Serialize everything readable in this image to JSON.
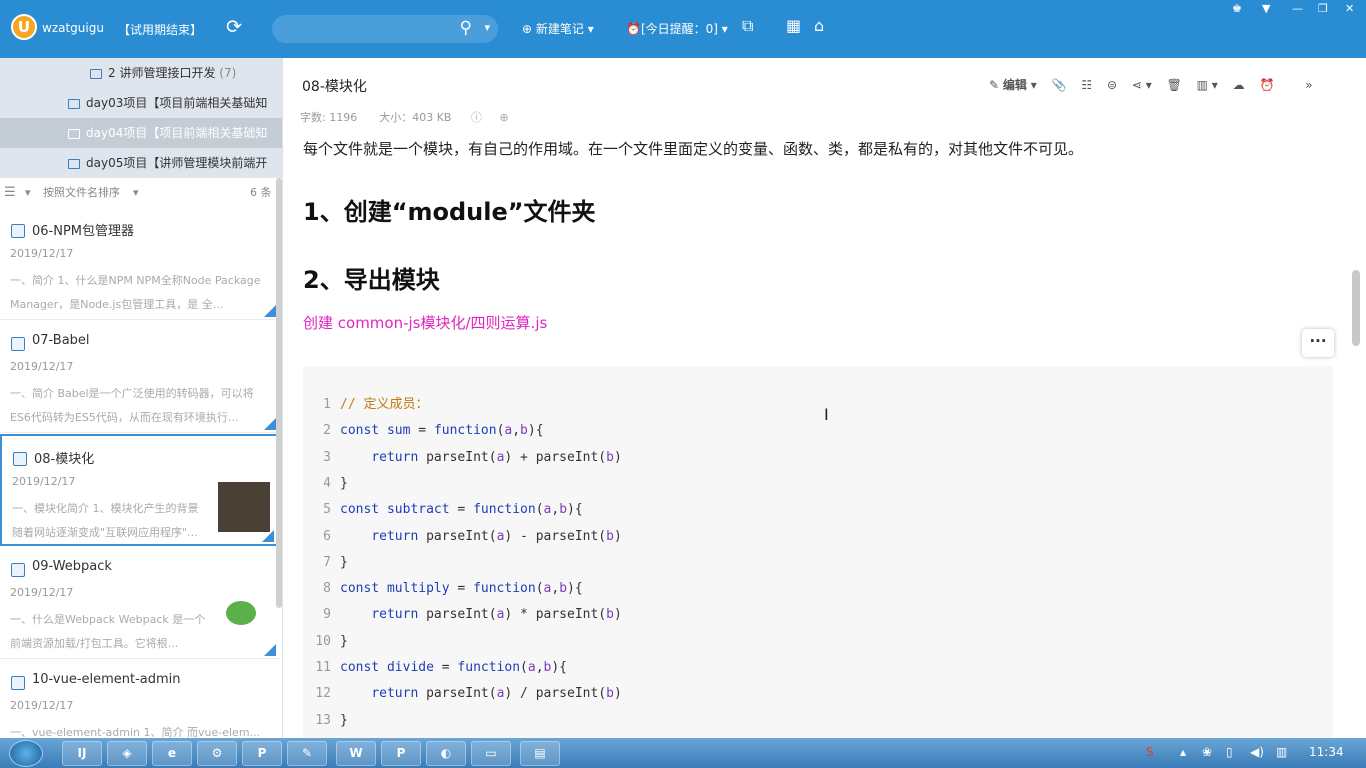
{
  "app": {
    "username": "wzatguigu",
    "trial_label": "【试用期结束】",
    "new_note_label": "新建笔记",
    "reminder_label": "[今日提醒：0]",
    "logo_letter": "U"
  },
  "tree": [
    {
      "label": "2 讲师管理接口开发",
      "count": "(7)"
    },
    {
      "label": "day03项目【项目前端相关基础知"
    },
    {
      "label": "day04项目【项目前端相关基础知"
    },
    {
      "label": "day05项目【讲师管理模块前端开"
    }
  ],
  "sort": {
    "label": "按照文件名排序",
    "count": "6 条"
  },
  "notes": [
    {
      "title": "06-NPM包管理器",
      "date": "2019/12/17",
      "excerpt": "一、简介 1、什么是NPM NPM全称Node Package Manager，是Node.js包管理工具，是 全..."
    },
    {
      "title": "07-Babel",
      "date": "2019/12/17",
      "excerpt": "一、简介 Babel是一个广泛使用的转码器，可以将ES6代码转为ES5代码，从而在现有环境执行..."
    },
    {
      "title": "08-模块化",
      "date": "2019/12/17",
      "excerpt": "一、模块化简介 1、模块化产生的背景 随着网站逐渐变成\"互联网应用程序\"..."
    },
    {
      "title": "09-Webpack",
      "date": "2019/12/17",
      "excerpt": "一、什么是Webpack Webpack 是一个前端资源加载/打包工具。它将根..."
    },
    {
      "title": "10-vue-element-admin",
      "date": "2019/12/17",
      "excerpt": "一、vue-element-admin 1、简介 而vue-elem..."
    }
  ],
  "note": {
    "title": "08-模块化",
    "meta": "字数: 1196　　大小：403 KB",
    "edit_label": "编辑",
    "intro": "每个文件就是一个模块，有自己的作用域。在一个文件里面定义的变量、函数、类，都是私有的，对其他文件不可见。",
    "heading1": "1、创建“module”文件夹",
    "heading2": "2、导出模块",
    "file_line": "创建 common-js模块化/四则运算.js",
    "more": "···"
  },
  "code_lines": [
    "// 定义成员：",
    "const sum = function(a,b){",
    "    return parseInt(a) + parseInt(b)",
    "}",
    "const subtract = function(a,b){",
    "    return parseInt(a) - parseInt(b)",
    "}",
    "const multiply = function(a,b){",
    "    return parseInt(a) * parseInt(b)",
    "}",
    "const divide = function(a,b){",
    "    return parseInt(a) / parseInt(b)",
    "}"
  ],
  "taskbar": {
    "clock": "11:34"
  }
}
